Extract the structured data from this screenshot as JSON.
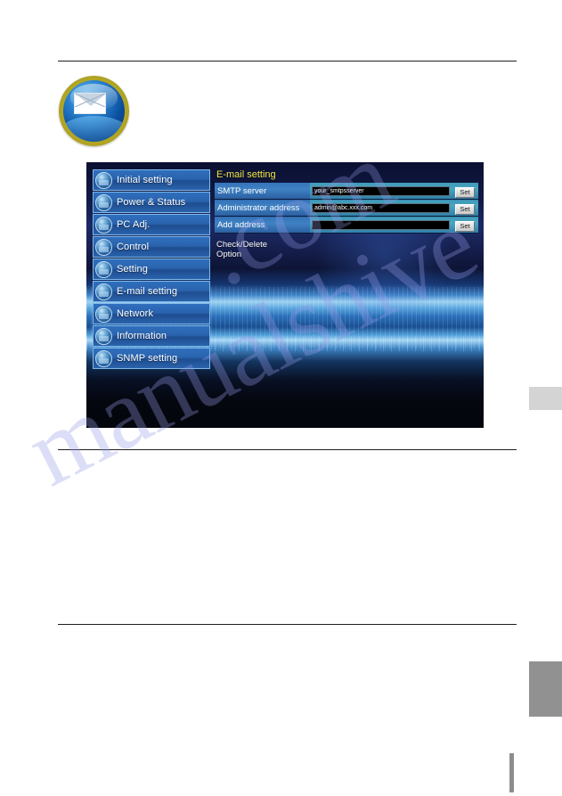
{
  "page": {
    "watermark": "manualshive.com",
    "watermark_part_1": "manualshive",
    "watermark_part_2": ".com"
  },
  "badge": {
    "icon": "envelope-icon"
  },
  "webui": {
    "sidebar": {
      "items": [
        {
          "label": "Initial setting",
          "icon": "initial-setting-icon",
          "active": false
        },
        {
          "label": "Power & Status",
          "icon": "power-status-icon",
          "active": false
        },
        {
          "label": "PC Adj.",
          "icon": "pc-adj-icon",
          "active": false
        },
        {
          "label": "Control",
          "icon": "control-icon",
          "active": false
        },
        {
          "label": "Setting",
          "icon": "setting-icon",
          "active": false
        },
        {
          "label": "E-mail setting",
          "icon": "email-setting-icon",
          "active": true
        },
        {
          "label": "Network",
          "icon": "network-icon",
          "active": false
        },
        {
          "label": "Information",
          "icon": "information-icon",
          "active": false
        },
        {
          "label": "SNMP setting",
          "icon": "snmp-setting-icon",
          "active": false
        }
      ]
    },
    "content": {
      "title": "E-mail setting",
      "title_color": "#f2e84a",
      "rows": [
        {
          "label": "SMTP server",
          "value": "your_smtpsserver",
          "button": "Set"
        },
        {
          "label": "Administrator address",
          "value": "admin@abc.xxx.com",
          "button": "Set"
        },
        {
          "label": "Add address",
          "value": "",
          "button": "Set"
        }
      ],
      "links": [
        {
          "label": "Check/Delete"
        },
        {
          "label": "Option"
        }
      ]
    }
  }
}
